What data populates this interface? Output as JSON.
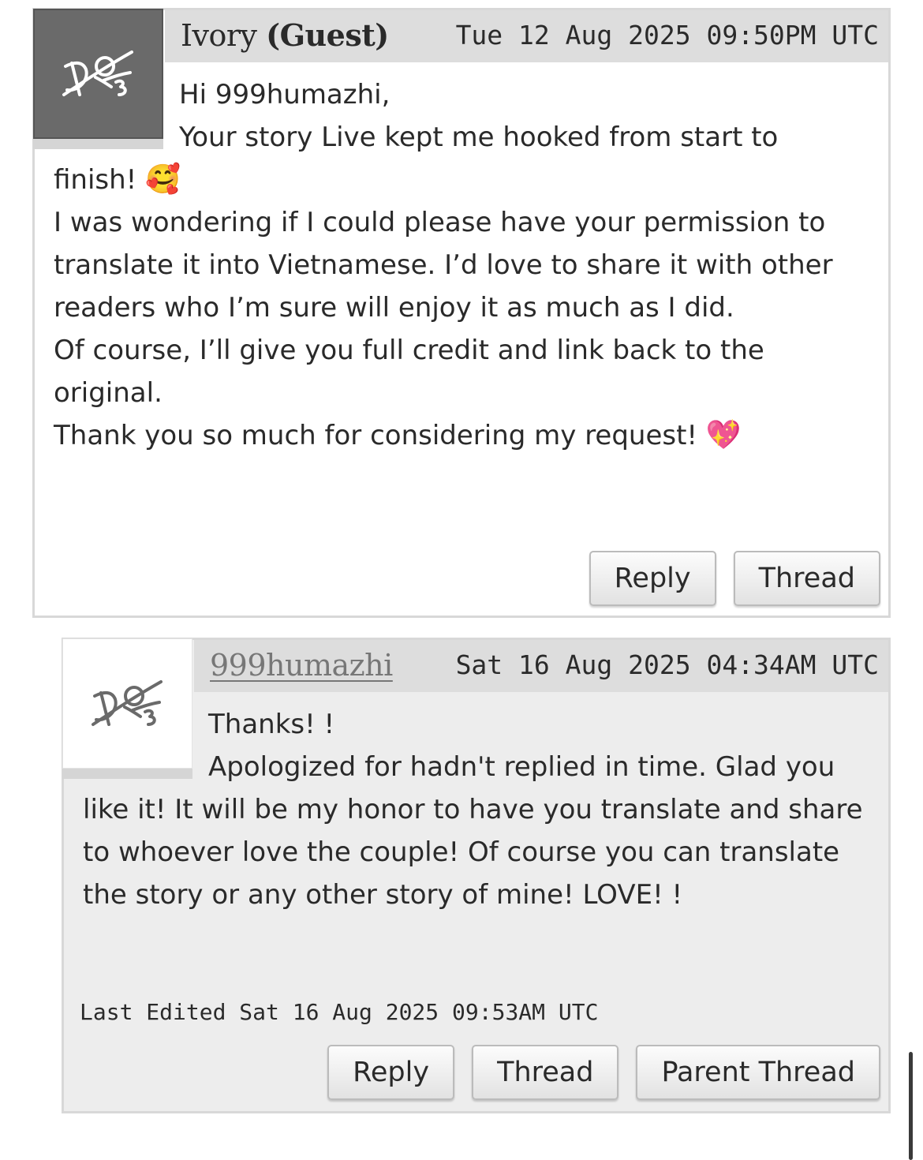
{
  "comments": [
    {
      "author": "Ivory",
      "author_suffix": "(Guest)",
      "date": "Tue 12 Aug 2025 09:50PM UTC",
      "icon": "default-user-icon",
      "body": [
        "Hi 999humazhi,",
        "Your story Live kept me hooked from start to finish! ",
        "I was wondering if I could please have your permission to translate it into Vietnamese. I’d love to share it with other readers who I’m sure will enjoy it as much as I did.",
        "Of course, I’ll give you full credit and link back to the original.",
        "Thank you so much for considering my request! "
      ],
      "emoji_smiling_hearts": "🥰",
      "emoji_sparkling_heart": "💖",
      "actions": {
        "reply": "Reply",
        "thread": "Thread"
      }
    },
    {
      "author": "999humazhi",
      "date": "Sat 16 Aug 2025 04:34AM UTC",
      "icon": "default-user-icon",
      "body": [
        "Thanks! !",
        "Apologized for hadn't replied in time. Glad you like it! It will be my honor to have you translate and share to whoever love the couple! Of course you can translate the story or any other story of mine! LOVE! !"
      ],
      "last_edited": "Last Edited Sat 16 Aug 2025 09:53AM UTC",
      "actions": {
        "reply": "Reply",
        "thread": "Thread",
        "parent_thread": "Parent Thread"
      }
    }
  ],
  "colors": {
    "header_bg": "#dddddd",
    "reply_bg": "#ededed",
    "guest_icon_bg": "#6a6a6a"
  }
}
